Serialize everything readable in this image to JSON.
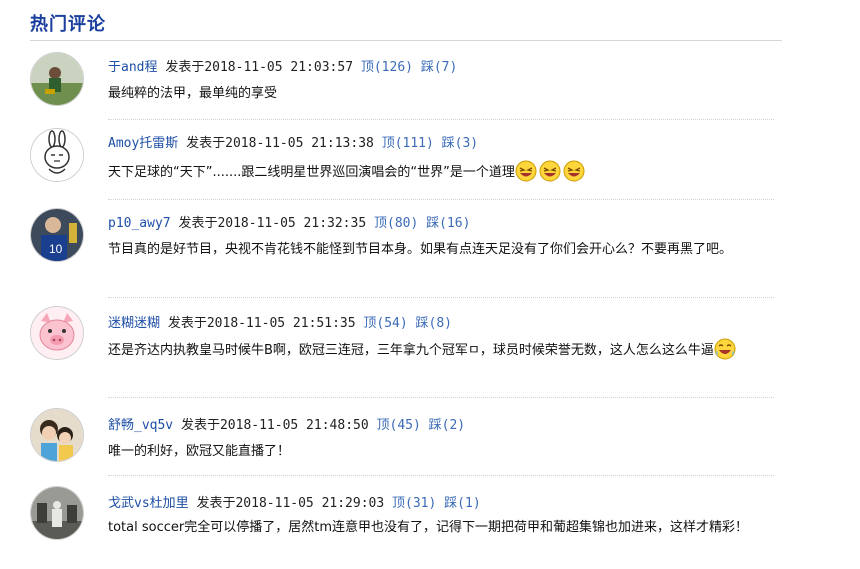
{
  "section": {
    "title": "热门评论"
  },
  "comments": [
    {
      "user": "于and程",
      "posted": "发表于2018-11-05 21:03:57",
      "up": "顶(126)",
      "down": "踩(7)",
      "text": "最纯粹的法甲，最单纯的享受",
      "emoji_count": 0,
      "avatar_icon": "soccer-player-photo"
    },
    {
      "user": "Amoy托雷斯",
      "posted": "发表于2018-11-05 21:13:38",
      "up": "顶(111)",
      "down": "踩(3)",
      "text": "天下足球的“天下”.......跟二线明星世界巡回演唱会的“世界”是一个道理",
      "emoji_count": 3,
      "avatar_icon": "cartoon-bunny"
    },
    {
      "user": "p10_awy7",
      "posted": "发表于2018-11-05 21:32:35",
      "up": "顶(80)",
      "down": "踩(16)",
      "text": "节目真的是好节目，央视不肯花钱不能怪到节目本身。如果有点连天足没有了你们会开心么？不要再黑了吧。",
      "emoji_count": 0,
      "avatar_icon": "player-number-10-photo"
    },
    {
      "user": "迷糊迷糊",
      "posted": "发表于2018-11-05 21:51:35",
      "up": "顶(54)",
      "down": "踩(8)",
      "text": "还是齐达内执教皇马时候牛B啊，欧冠三连冠，三年拿九个冠军ㅁ，球员时候荣誉无数，这人怎么这么牛逼",
      "emoji_count": 1,
      "avatar_icon": "cartoon-pig"
    },
    {
      "user": "舒畅_vq5v",
      "posted": "发表于2018-11-05 21:48:50",
      "up": "顶(45)",
      "down": "踩(2)",
      "text": "唯一的利好，欧冠又能直播了！",
      "emoji_count": 0,
      "avatar_icon": "child-photo"
    },
    {
      "user": "戈武vs杜加里",
      "posted": "发表于2018-11-05 21:29:03",
      "up": "顶(31)",
      "down": "踩(1)",
      "text": "total soccer完全可以停播了，居然tm连意甲也没有了，记得下一期把荷甲和葡超集锦也加进来，这样才精彩！",
      "emoji_count": 0,
      "avatar_icon": "monument-photo"
    }
  ]
}
